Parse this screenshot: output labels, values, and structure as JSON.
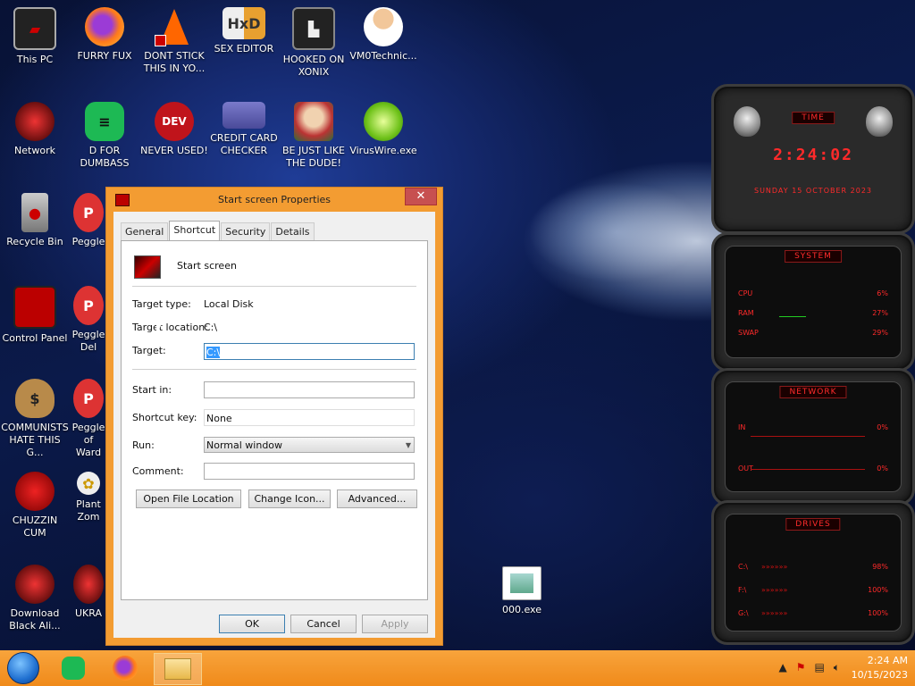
{
  "desktop": {
    "icons": [
      {
        "label": "This PC",
        "icon": "this-pc-icon"
      },
      {
        "label": "FURRY FUX",
        "icon": "firefox-icon"
      },
      {
        "label": "DONT STICK THIS IN YO...",
        "icon": "vlc-cone-icon"
      },
      {
        "label": "SEX EDITOR",
        "icon": "hxd-editor-icon"
      },
      {
        "label": "HOOKED ON XONIX",
        "icon": "xonix-game-icon"
      },
      {
        "label": "VM0Technic...",
        "icon": "doctor-avatar-icon"
      },
      {
        "label": "Network",
        "icon": "network-icon"
      },
      {
        "label": "D FOR DUMBASS",
        "icon": "green-app-icon"
      },
      {
        "label": "NEVER USED!",
        "icon": "devcpp-icon"
      },
      {
        "label": "CREDIT CARD CHECKER",
        "icon": "credit-card-icon"
      },
      {
        "label": "BE JUST LIKE THE DUDE!",
        "icon": "santa-game-icon"
      },
      {
        "label": "VirusWire.exe",
        "icon": "limewire-icon"
      },
      {
        "label": "Recycle Bin",
        "icon": "recycle-bin-icon"
      },
      {
        "label": "Peggle",
        "icon": "peggle-icon"
      },
      {
        "label": "Control Panel",
        "icon": "control-panel-icon"
      },
      {
        "label": "Peggle Del",
        "icon": "peggle-deluxe-icon"
      },
      {
        "label": "COMMUNISTS HATE THIS G...",
        "icon": "money-bag-icon"
      },
      {
        "label": "Peggle of Ward",
        "icon": "peggle-wow-icon"
      },
      {
        "label": "CHUZZIN CUM",
        "icon": "chuzzle-icon"
      },
      {
        "label": "Plant Zom",
        "icon": "pvz-icon"
      },
      {
        "label": "Download Black Ali...",
        "icon": "alienware-icon"
      },
      {
        "label": "UKRA",
        "icon": "ukraine-icon"
      },
      {
        "label": "000.exe",
        "icon": "exe-file-icon"
      }
    ]
  },
  "dialog": {
    "title": "Start screen Properties",
    "close_label": "✕",
    "tabs": [
      "General",
      "Shortcut",
      "Security",
      "Details"
    ],
    "name": "Start screen",
    "target_type_label": "Target type:",
    "target_type_value": "Local Disk",
    "target_location_label": "Target location:",
    "target_location_value": "C:\\",
    "target_label": "Target:",
    "target_value": "C:\\",
    "start_in_label": "Start in:",
    "start_in_value": "",
    "shortcut_key_label": "Shortcut key:",
    "shortcut_key_value": "None",
    "run_label": "Run:",
    "run_value": "Normal window",
    "comment_label": "Comment:",
    "comment_value": "",
    "open_location_btn": "Open File Location",
    "change_icon_btn": "Change Icon...",
    "advanced_btn": "Advanced...",
    "ok_btn": "OK",
    "cancel_btn": "Cancel",
    "apply_btn": "Apply"
  },
  "widgets": {
    "time": {
      "header": "TIME",
      "clock": "2:24:02",
      "date": "SUNDAY 15 OCTOBER 2023"
    },
    "system": {
      "header": "SYSTEM",
      "rows": [
        {
          "label": "CPU",
          "value": "6%"
        },
        {
          "label": "RAM",
          "value": "27%"
        },
        {
          "label": "SWAP",
          "value": "29%"
        }
      ]
    },
    "network": {
      "header": "NETWORK",
      "rows": [
        {
          "label": "IN",
          "value": "0%"
        },
        {
          "label": "OUT",
          "value": "0%"
        }
      ]
    },
    "drives": {
      "header": "DRIVES",
      "rows": [
        {
          "label": "C:\\",
          "value": "98%"
        },
        {
          "label": "F:\\",
          "value": "100%"
        },
        {
          "label": "G:\\",
          "value": "100%"
        }
      ]
    }
  },
  "taskbar": {
    "time": "2:24 AM",
    "date": "10/15/2023"
  },
  "colors": {
    "taskbar": "#f39c32",
    "accent_red": "#ff2a2a"
  }
}
